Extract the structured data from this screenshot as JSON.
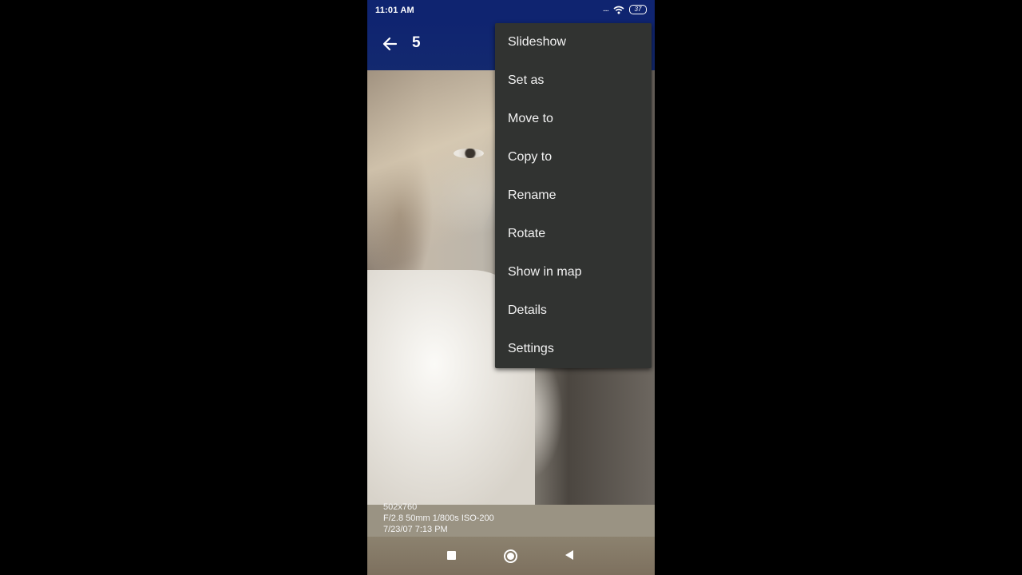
{
  "status_bar": {
    "time": "11:01 AM",
    "signal_text": "....",
    "battery_level": "37",
    "icons": [
      "signal-dots-icon",
      "wifi-icon",
      "battery-icon"
    ]
  },
  "app_bar": {
    "title": "5",
    "back_icon": "arrow-back-icon"
  },
  "overflow_menu": {
    "items": [
      {
        "label": "Slideshow"
      },
      {
        "label": "Set as"
      },
      {
        "label": "Move to"
      },
      {
        "label": "Copy to"
      },
      {
        "label": "Rename"
      },
      {
        "label": "Rotate"
      },
      {
        "label": "Show in map"
      },
      {
        "label": "Details"
      },
      {
        "label": "Settings"
      }
    ]
  },
  "photo_details": {
    "resolution": "502x760",
    "exposure": "F/2.8 50mm 1/800s ISO-200",
    "date": "7/23/07 7:13 PM"
  },
  "nav_bar": {
    "icons": [
      "recents-square-icon",
      "home-circle-icon",
      "back-triangle-icon"
    ]
  },
  "colors": {
    "app_bar": "#0f2470",
    "menu_background": "#313331",
    "menu_text": "#f2f2f2"
  }
}
